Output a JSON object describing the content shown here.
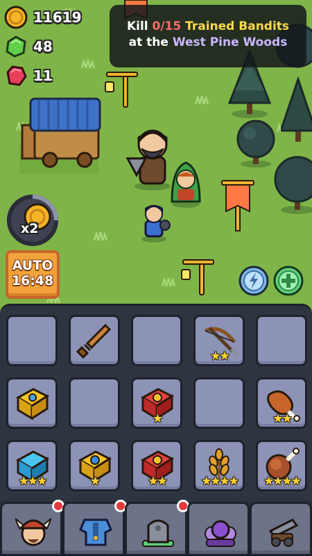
{
  "resources": {
    "gold": "11619",
    "emerald": "48",
    "ruby": "11"
  },
  "quest": {
    "prefix": "Kill ",
    "progress": "0/15",
    "target": " Trained Bandits",
    "line2_prefix": "at the ",
    "location": "West Pine Woods"
  },
  "speed": {
    "label": "x2"
  },
  "auto": {
    "label": "AUTO",
    "timer": "16:48"
  },
  "inventory": {
    "slots": [
      {
        "item": "empty",
        "stars": ""
      },
      {
        "item": "wooden-sword",
        "stars": ""
      },
      {
        "item": "empty",
        "stars": ""
      },
      {
        "item": "crossbow",
        "stars": "★★"
      },
      {
        "item": "empty",
        "stars": ""
      },
      {
        "item": "gold-book",
        "stars": ""
      },
      {
        "item": "empty",
        "stars": ""
      },
      {
        "item": "red-book",
        "stars": "★"
      },
      {
        "item": "empty",
        "stars": ""
      },
      {
        "item": "meat-bone",
        "stars": "★★"
      },
      {
        "item": "blue-book",
        "stars": "★★★"
      },
      {
        "item": "gold-book-sapphire",
        "stars": "★"
      },
      {
        "item": "red-book",
        "stars": "★★"
      },
      {
        "item": "wheat",
        "stars": "★★★★"
      },
      {
        "item": "roast-leg",
        "stars": "★★★★"
      }
    ]
  },
  "nav": {
    "tabs": [
      {
        "name": "heroes",
        "notification": true
      },
      {
        "name": "armor",
        "notification": true
      },
      {
        "name": "graveyard",
        "notification": true
      },
      {
        "name": "party",
        "notification": false
      },
      {
        "name": "siege",
        "notification": false
      }
    ]
  },
  "colors": {
    "grass": "#7fb548",
    "panel": "#2f3441",
    "slot": "#8c93b6",
    "auto": "#f2a23a",
    "star": "#ffcd2e"
  }
}
